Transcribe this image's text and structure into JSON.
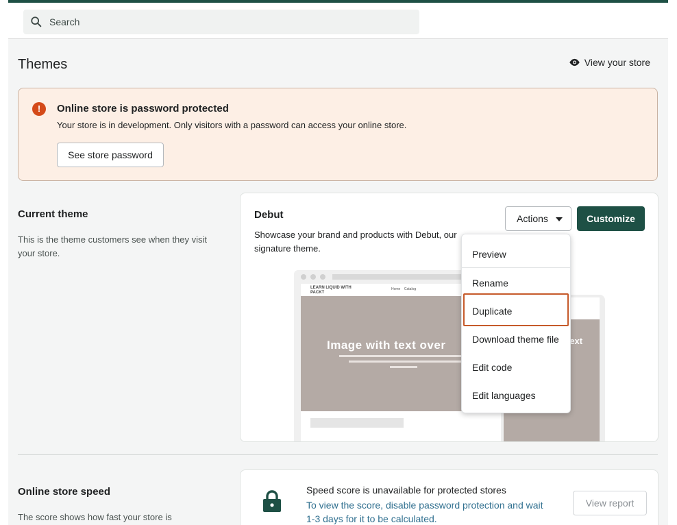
{
  "search": {
    "placeholder": "Search"
  },
  "header": {
    "title": "Themes",
    "view_store_label": "View your store"
  },
  "banner": {
    "title": "Online store is password protected",
    "text": "Your store is in development. Only visitors with a password can access your online store.",
    "button_label": "See store password"
  },
  "current_theme": {
    "section_title": "Current theme",
    "section_desc": "This is the theme customers see when they visit your store.",
    "name": "Debut",
    "description": "Showcase your brand and products with Debut, our signature theme.",
    "actions_label": "Actions",
    "customize_label": "Customize",
    "preview": {
      "logo_text": "LEARN LIQUID WITH PACKT",
      "nav": [
        "Home",
        "Catalog"
      ],
      "hero_title": "Image with text over",
      "mobile_text": "text"
    }
  },
  "actions_menu": {
    "items": [
      "Preview",
      "Rename",
      "Duplicate",
      "Download theme file",
      "Edit code",
      "Edit languages"
    ],
    "highlighted": "Duplicate"
  },
  "speed": {
    "section_title": "Online store speed",
    "section_desc": "The score shows how fast your store is",
    "title": "Speed score is unavailable for protected stores",
    "text": "To view the score, disable password protection and wait 1-3 days for it to be calculated.",
    "button_label": "View report"
  },
  "colors": {
    "brand": "#1e5045",
    "critical": "#d44a19",
    "banner_bg": "#fdefe5",
    "highlight": "#c65a2a"
  }
}
